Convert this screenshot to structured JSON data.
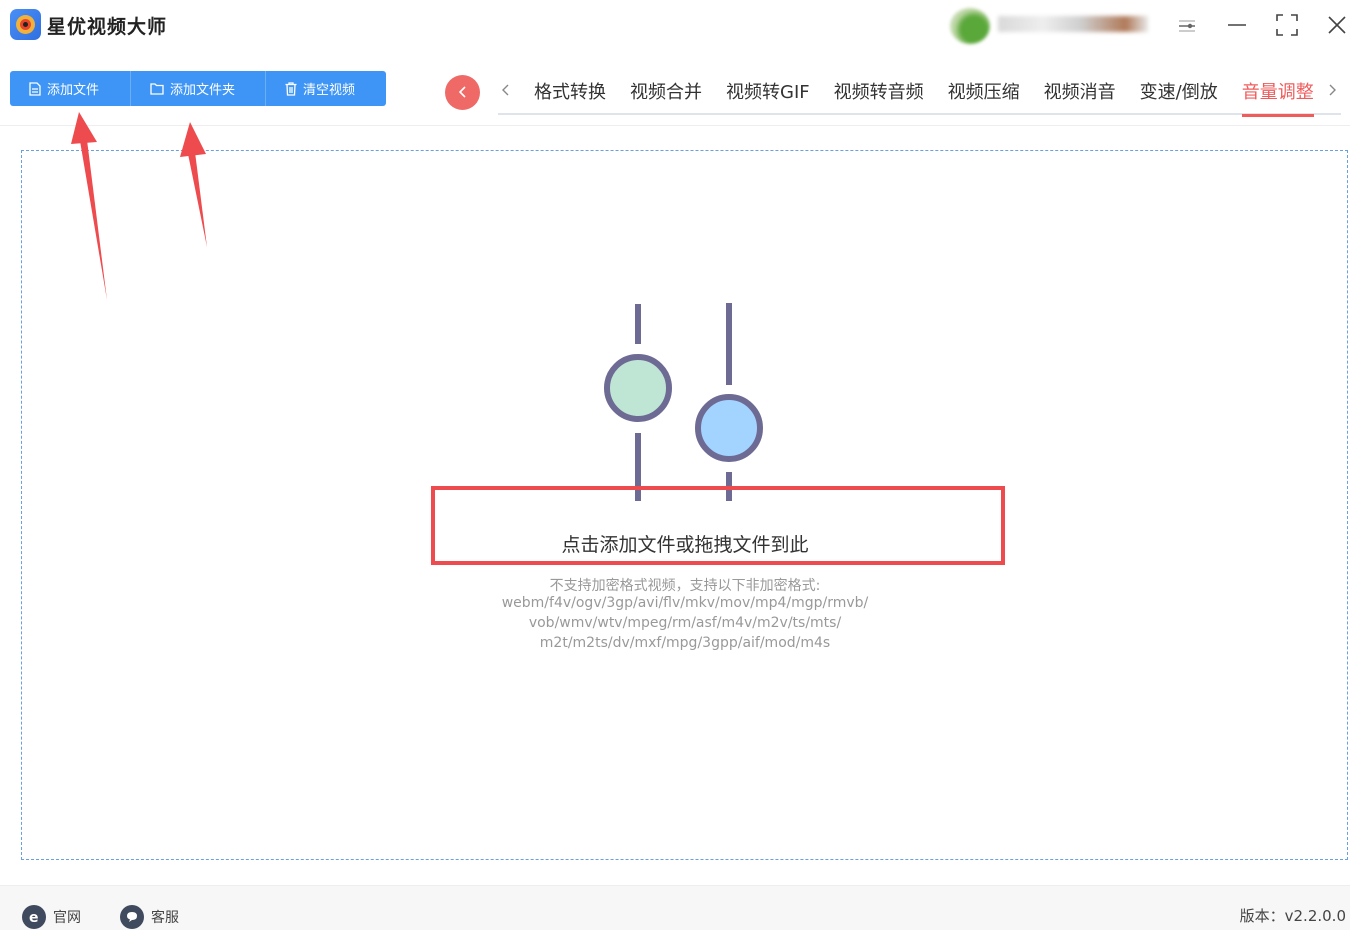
{
  "app": {
    "title": "星优视频大师"
  },
  "toolbar": {
    "add_file": "添加文件",
    "add_folder": "添加文件夹",
    "clear_videos": "清空视频"
  },
  "tabs": [
    {
      "label": "格式转换",
      "active": false
    },
    {
      "label": "视频合并",
      "active": false
    },
    {
      "label": "视频转GIF",
      "active": false
    },
    {
      "label": "视频转音频",
      "active": false
    },
    {
      "label": "视频压缩",
      "active": false
    },
    {
      "label": "视频消音",
      "active": false
    },
    {
      "label": "变速/倒放",
      "active": false
    },
    {
      "label": "音量调整",
      "active": true
    }
  ],
  "drop": {
    "main_text": "点击添加文件或拖拽文件到此",
    "note": "不支持加密格式视频，支持以下非加密格式:",
    "formats_line1": "webm/f4v/ogv/3gp/avi/flv/mkv/mov/mp4/mgp/rmvb/",
    "formats_line2": "vob/wmv/wtv/mpeg/rm/asf/m4v/m2v/ts/mts/",
    "formats_line3": "m2t/m2ts/dv/mxf/mpg/3gpp/aif/mod/m4s"
  },
  "footer": {
    "website": "官网",
    "support": "客服",
    "version": "版本：v2.2.0.0"
  },
  "colors": {
    "primary": "#3e95f6",
    "accent_red": "#ef5c5c",
    "highlight_box": "#ee4b4e",
    "knob_green": "#bfe5d5",
    "knob_blue": "#a3d3ff",
    "slider_stroke": "#6d6a94"
  },
  "icons": [
    "app-logo",
    "file-icon",
    "folder-icon",
    "trash-icon",
    "chevron-left-icon",
    "chevron-right-icon",
    "settings-icon",
    "minimize-icon",
    "fullscreen-icon",
    "close-icon",
    "website-icon",
    "support-icon"
  ]
}
